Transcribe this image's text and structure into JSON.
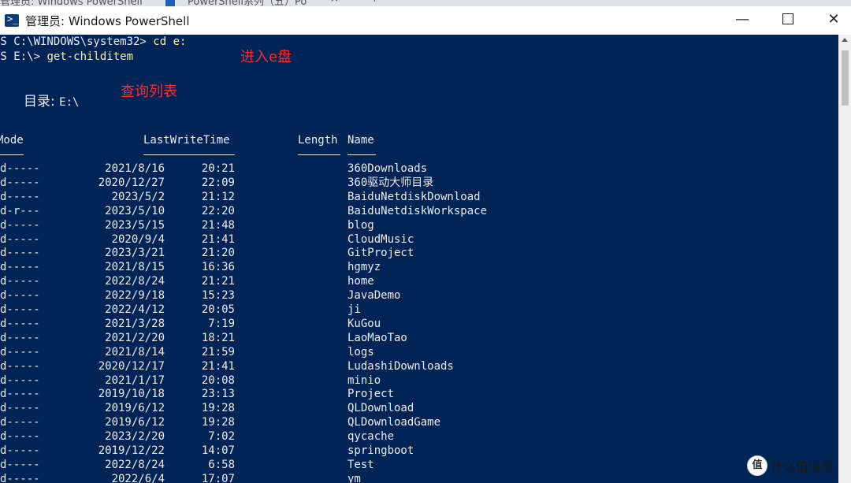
{
  "browser_tabs": {
    "tab1_label": "管理员: Windows PowerShell",
    "tab2_label": "PowerShell系列（五）Po",
    "close_glyph": "×",
    "new_tab_glyph": "+"
  },
  "window": {
    "title": "管理员: Windows PowerShell",
    "minimize_glyph": "—",
    "close_glyph": "✕"
  },
  "console": {
    "prompt1": "PS C:\\WINDOWS\\system32> ",
    "command1": "cd e:",
    "prompt2": "PS E:\\> ",
    "command2": "get-childitem",
    "annotation_enter": "进入e盘",
    "annotation_query": "查询列表",
    "directory_label": "目录: ",
    "directory_path": "E:\\",
    "headers": {
      "mode": "Mode",
      "lastwritetime": "LastWriteTime",
      "length": "Length",
      "name": "Name"
    },
    "rows": [
      {
        "mode": "d-----",
        "date": "2021/8/16",
        "time": "20:21",
        "name": "360Downloads"
      },
      {
        "mode": "d-----",
        "date": "2020/12/27",
        "time": "22:09",
        "name": "360驱动大师目录"
      },
      {
        "mode": "d-----",
        "date": "2023/5/2",
        "time": "21:12",
        "name": "BaiduNetdiskDownload"
      },
      {
        "mode": "d-r---",
        "date": "2023/5/10",
        "time": "22:20",
        "name": "BaiduNetdiskWorkspace"
      },
      {
        "mode": "d-----",
        "date": "2023/5/15",
        "time": "21:48",
        "name": "blog"
      },
      {
        "mode": "d-----",
        "date": "2020/9/4",
        "time": "21:41",
        "name": "CloudMusic"
      },
      {
        "mode": "d-----",
        "date": "2023/3/21",
        "time": "21:20",
        "name": "GitProject"
      },
      {
        "mode": "d-----",
        "date": "2021/8/15",
        "time": "16:36",
        "name": "hgmyz"
      },
      {
        "mode": "d-----",
        "date": "2022/8/24",
        "time": "21:21",
        "name": "home"
      },
      {
        "mode": "d-----",
        "date": "2022/9/18",
        "time": "15:23",
        "name": "JavaDemo"
      },
      {
        "mode": "d-----",
        "date": "2022/4/12",
        "time": "20:05",
        "name": "ji"
      },
      {
        "mode": "d-----",
        "date": "2021/3/28",
        "time": "7:19",
        "name": "KuGou"
      },
      {
        "mode": "d-----",
        "date": "2021/2/20",
        "time": "18:21",
        "name": "LaoMaoTao"
      },
      {
        "mode": "d-----",
        "date": "2021/8/14",
        "time": "21:59",
        "name": "logs"
      },
      {
        "mode": "d-----",
        "date": "2020/12/17",
        "time": "21:41",
        "name": "LudashiDownloads"
      },
      {
        "mode": "d-----",
        "date": "2021/1/17",
        "time": "20:08",
        "name": "minio"
      },
      {
        "mode": "d-----",
        "date": "2019/10/18",
        "time": "23:13",
        "name": "Project"
      },
      {
        "mode": "d-----",
        "date": "2019/6/12",
        "time": "19:28",
        "name": "QLDownload"
      },
      {
        "mode": "d-----",
        "date": "2019/6/12",
        "time": "19:28",
        "name": "QLDownloadGame"
      },
      {
        "mode": "d-----",
        "date": "2023/2/20",
        "time": "7:02",
        "name": "qycache"
      },
      {
        "mode": "d-----",
        "date": "2019/12/22",
        "time": "14:07",
        "name": "springboot"
      },
      {
        "mode": "d-----",
        "date": "2022/8/24",
        "time": "6:58",
        "name": "Test"
      },
      {
        "mode": "d-----",
        "date": "2022/6/4",
        "time": "17:07",
        "name": "ym"
      }
    ]
  },
  "watermark": {
    "logo_glyph": "值",
    "text": "什么值得买"
  },
  "colors": {
    "console_bg": "#012456",
    "console_text": "#eeedf0",
    "command_yellow": "#f9f1a5",
    "annotation_red": "#ff2a2a"
  }
}
